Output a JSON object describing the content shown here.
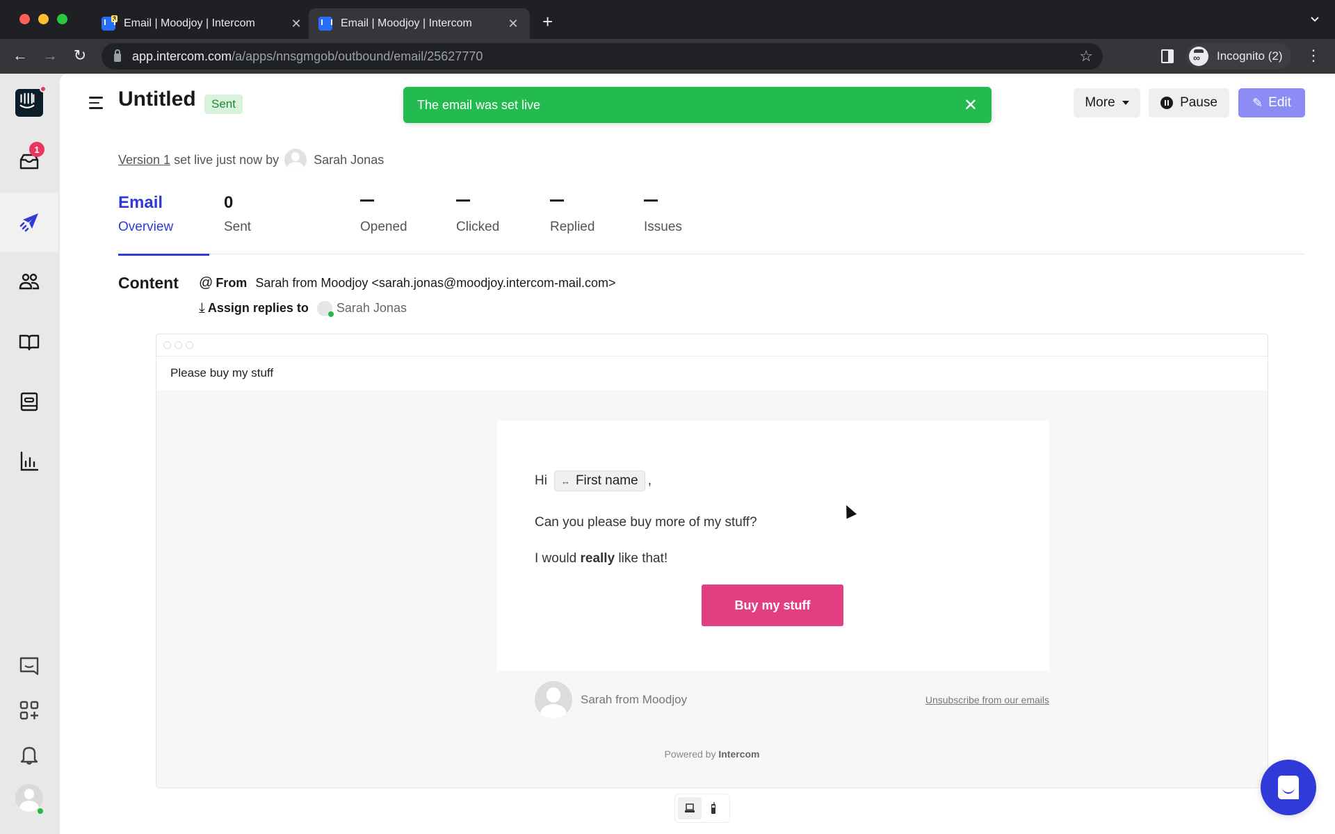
{
  "browser": {
    "tabs": [
      {
        "title": "Email | Moodjoy | Intercom",
        "badge": "3",
        "active": false
      },
      {
        "title": "Email | Moodjoy | Intercom",
        "active": true
      }
    ],
    "url_host": "app.intercom.com",
    "url_path": "/a/apps/nnsgmgob/outbound/email/25627770",
    "profile_label": "Incognito (2)",
    "icons": {
      "back": "←",
      "forward": "→",
      "reload": "↻",
      "star": "☆",
      "close": "✕",
      "new_tab": "+",
      "menu": "⋮",
      "tabs_dropdown": "⌄"
    }
  },
  "sidebar": {
    "inbox_badge": "1",
    "items": [
      {
        "name": "intercom-logo"
      },
      {
        "name": "inbox"
      },
      {
        "name": "outbound",
        "active": true
      },
      {
        "name": "contacts"
      },
      {
        "name": "articles"
      },
      {
        "name": "reports-book"
      },
      {
        "name": "reports"
      },
      {
        "name": "messenger"
      },
      {
        "name": "apps"
      },
      {
        "name": "notifications"
      },
      {
        "name": "profile"
      }
    ]
  },
  "header": {
    "title": "Untitled",
    "status": "Sent",
    "toast": "The email was set live",
    "toast_close": "✕",
    "more_label": "More",
    "pause_label": "Pause",
    "edit_label": "Edit",
    "edit_icon": "✎"
  },
  "version": {
    "link": "Version 1",
    "text": "set live just now by",
    "author": "Sarah Jonas"
  },
  "stats": [
    {
      "top": "Email",
      "label": "Overview",
      "active": true
    },
    {
      "top": "0",
      "label": "Sent"
    },
    {
      "top": "—",
      "label": "Opened"
    },
    {
      "top": "—",
      "label": "Clicked"
    },
    {
      "top": "—",
      "label": "Replied"
    },
    {
      "top": "—",
      "label": "Issues"
    }
  ],
  "content": {
    "heading": "Content",
    "from_icon": "@",
    "from_key": "From",
    "from_value": "Sarah from Moodjoy <sarah.jonas@moodjoy.intercom-mail.com>",
    "assign_icon": "⤓",
    "assign_key": "Assign replies to",
    "assignee": "Sarah Jonas"
  },
  "email": {
    "subject": "Please buy my stuff",
    "greeting": "Hi",
    "attribute_icon": "↔",
    "attribute": "First name",
    "greeting_suffix": ",",
    "line1": "Can you please buy more of my stuff?",
    "line2_pre": "I would ",
    "line2_bold": "really",
    "line2_post": " like that!",
    "cta": "Buy my stuff",
    "sender": "Sarah from Moodjoy",
    "unsubscribe": "Unsubscribe from our emails",
    "powered_by": "Powered by",
    "powered_brand": "Intercom",
    "cta_color": "#e23e82"
  },
  "device_toggle": {
    "desktop_icon": "💻",
    "mobile_icon": "📱",
    "active": "desktop"
  },
  "colors": {
    "accent": "#2f3ad9",
    "toast": "#23ba4f",
    "edit_button": "#8c8cf5",
    "badge": "#e8375f"
  }
}
